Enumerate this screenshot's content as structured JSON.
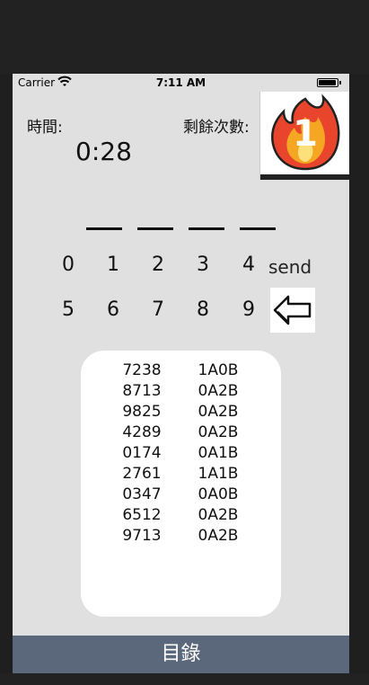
{
  "status": {
    "carrier": "Carrier",
    "time": "7:11 AM"
  },
  "labels": {
    "time": "時間:",
    "remaining": "剩餘次數:"
  },
  "timer": "0:28",
  "remaining_count": "1",
  "keypad": {
    "row1": [
      "0",
      "1",
      "2",
      "3",
      "4"
    ],
    "row2": [
      "5",
      "6",
      "7",
      "8",
      "9"
    ],
    "send": "send"
  },
  "history": [
    {
      "guess": "7238",
      "result": "1A0B"
    },
    {
      "guess": "8713",
      "result": "0A2B"
    },
    {
      "guess": "9825",
      "result": "0A2B"
    },
    {
      "guess": "4289",
      "result": "0A2B"
    },
    {
      "guess": "0174",
      "result": "0A1B"
    },
    {
      "guess": "2761",
      "result": "1A1B"
    },
    {
      "guess": "0347",
      "result": "0A0B"
    },
    {
      "guess": "6512",
      "result": "0A2B"
    },
    {
      "guess": "9713",
      "result": "0A2B"
    }
  ],
  "tabbar": {
    "label": "目錄"
  }
}
